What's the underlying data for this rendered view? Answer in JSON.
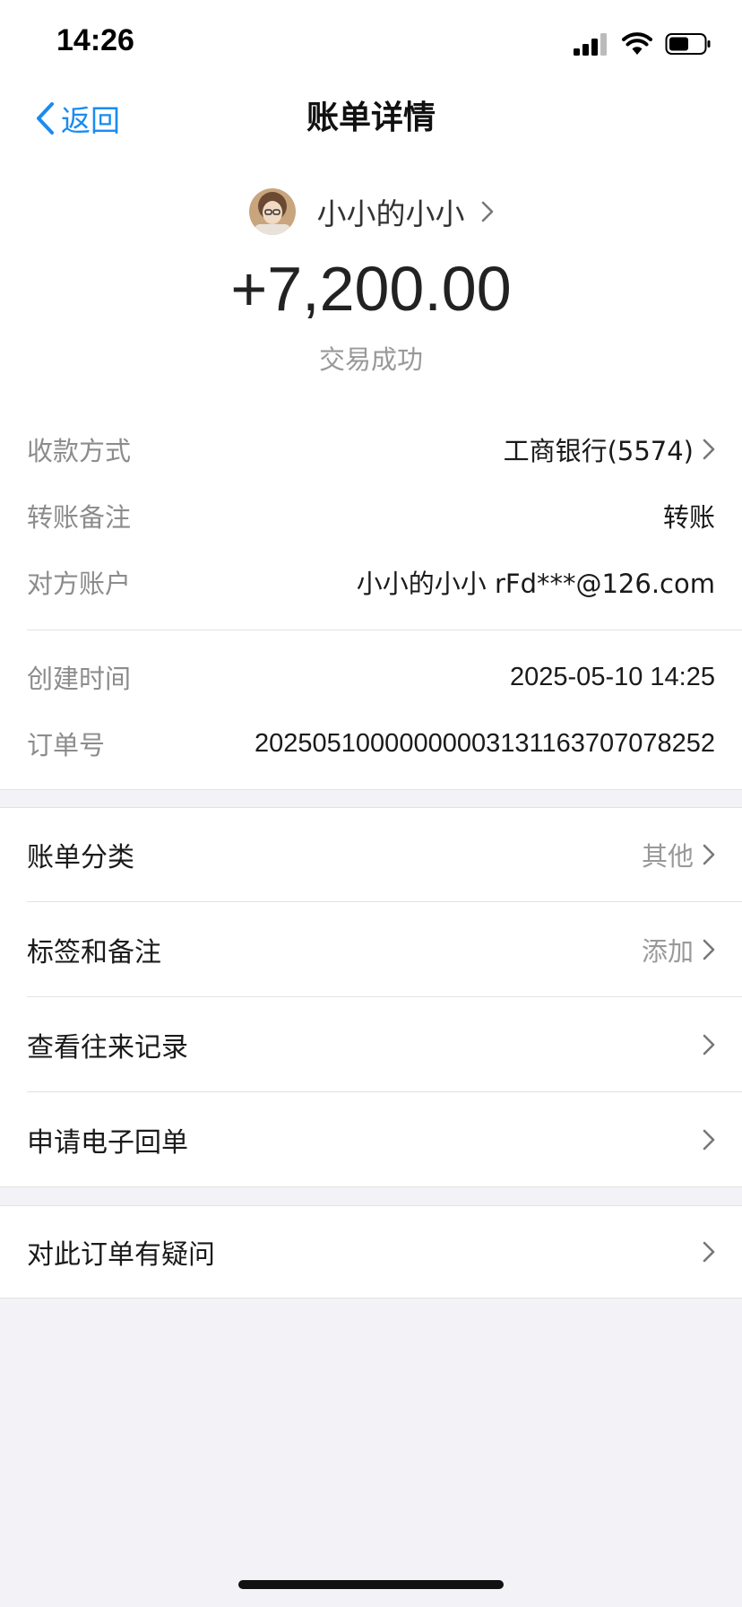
{
  "status_bar": {
    "time": "14:26"
  },
  "nav": {
    "back_label": "返回",
    "title": "账单详情"
  },
  "header": {
    "counterpart_name": "小小的小小",
    "amount": "+7,200.00",
    "status": "交易成功"
  },
  "details": [
    {
      "label": "收款方式",
      "value": "工商银行(5574)"
    },
    {
      "label": "转账备注",
      "value": "转账"
    },
    {
      "label": "对方账户",
      "value": "小小的小小 rFd***@126.com"
    },
    {
      "label": "创建时间",
      "value": "2025-05-10 14:25"
    },
    {
      "label": "订单号",
      "value": "20250510000000003131163707078252"
    }
  ],
  "menu": [
    {
      "label": "账单分类",
      "value": "其他"
    },
    {
      "label": "标签和备注",
      "value": "添加"
    },
    {
      "label": "查看往来记录",
      "value": ""
    },
    {
      "label": "申请电子回单",
      "value": ""
    }
  ],
  "help": {
    "label": "对此订单有疑问"
  },
  "colors": {
    "accent": "#1a8bf0",
    "background": "#f2f2f7"
  }
}
